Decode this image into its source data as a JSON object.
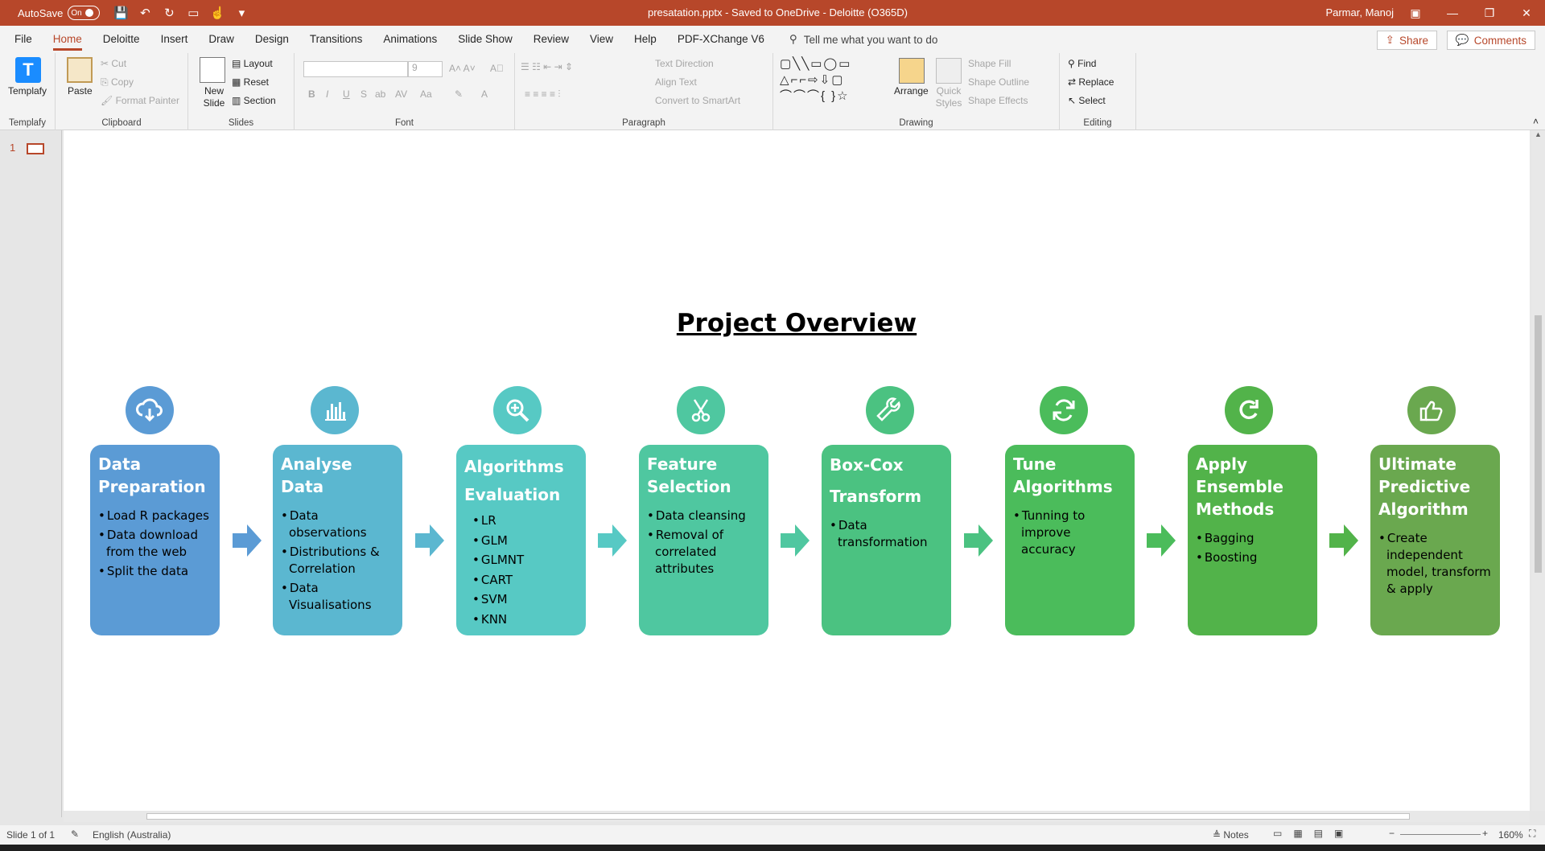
{
  "titlebar": {
    "autosave_label": "AutoSave",
    "autosave_state": "On",
    "doc_title": "presatation.pptx  -  Saved to OneDrive - Deloitte (O365D)",
    "user_name": "Parmar, Manoj"
  },
  "menu": {
    "tabs": [
      "File",
      "Home",
      "Deloitte",
      "Insert",
      "Draw",
      "Design",
      "Transitions",
      "Animations",
      "Slide Show",
      "Review",
      "View",
      "Help",
      "PDF-XChange V6"
    ],
    "active_tab": "Home",
    "tell_me": "Tell me what you want to do",
    "share": "Share",
    "comments": "Comments"
  },
  "ribbon": {
    "templafy": {
      "label": "Templafy",
      "group": "Templafy"
    },
    "clipboard": {
      "paste": "Paste",
      "cut": "Cut",
      "copy": "Copy",
      "format_painter": "Format Painter",
      "group": "Clipboard"
    },
    "slides": {
      "new_slide": "New Slide",
      "layout": "Layout",
      "reset": "Reset",
      "section": "Section",
      "group": "Slides"
    },
    "font": {
      "font_size": "9",
      "bold": "B",
      "italic": "I",
      "underline": "U",
      "strike": "S",
      "group": "Font"
    },
    "paragraph": {
      "text_direction": "Text Direction",
      "align_text": "Align Text",
      "convert_smartart": "Convert to SmartArt",
      "group": "Paragraph"
    },
    "drawing": {
      "arrange": "Arrange",
      "quick_styles": "Quick Styles",
      "shape_fill": "Shape Fill",
      "shape_outline": "Shape Outline",
      "shape_effects": "Shape Effects",
      "group": "Drawing"
    },
    "editing": {
      "find": "Find",
      "replace": "Replace",
      "select": "Select",
      "group": "Editing"
    }
  },
  "thumbnails": {
    "number": "1"
  },
  "slide": {
    "title": "Project Overview",
    "steps": [
      {
        "title": "Data Preparation",
        "icon": "cloud-download-icon",
        "color": "#5b9bd5",
        "bullets": [
          "Load R packages",
          "Data download from the web",
          "Split the data"
        ]
      },
      {
        "title": "Analyse Data",
        "icon": "bar-chart-icon",
        "color": "#5bb7d0",
        "bullets": [
          "Data observations",
          "Distributions & Correlation",
          "Data Visualisations"
        ]
      },
      {
        "title": "Algorithms Evaluation",
        "icon": "magnifier-icon",
        "color": "#57c9c4",
        "bullets": [
          "LR",
          "GLM",
          "GLMNT",
          "CART",
          "SVM",
          "KNN"
        ]
      },
      {
        "title": "Feature Selection",
        "icon": "scissors-icon",
        "color": "#4fc7a0",
        "bullets": [
          "Data cleansing",
          "Removal of correlated attributes"
        ]
      },
      {
        "title": "Box-Cox Transform",
        "icon": "wrench-icon",
        "color": "#4bc281",
        "bullets": [
          "Data transformation"
        ]
      },
      {
        "title": "Tune Algorithms",
        "icon": "refresh-icon",
        "color": "#4bbc5b",
        "bullets": [
          "Tunning to improve accuracy"
        ]
      },
      {
        "title": "Apply Ensemble Methods",
        "icon": "rotate-icon",
        "color": "#52b34a",
        "bullets": [
          "Bagging",
          "Boosting"
        ]
      },
      {
        "title": "Ultimate Predictive Algorithm",
        "icon": "thumbs-up-icon",
        "color": "#6aa84f",
        "bullets": [
          "Create independent model, transform & apply"
        ]
      }
    ]
  },
  "status": {
    "slide_count": "Slide 1 of 1",
    "language": "English (Australia)",
    "notes": "Notes",
    "zoom": "160%"
  }
}
